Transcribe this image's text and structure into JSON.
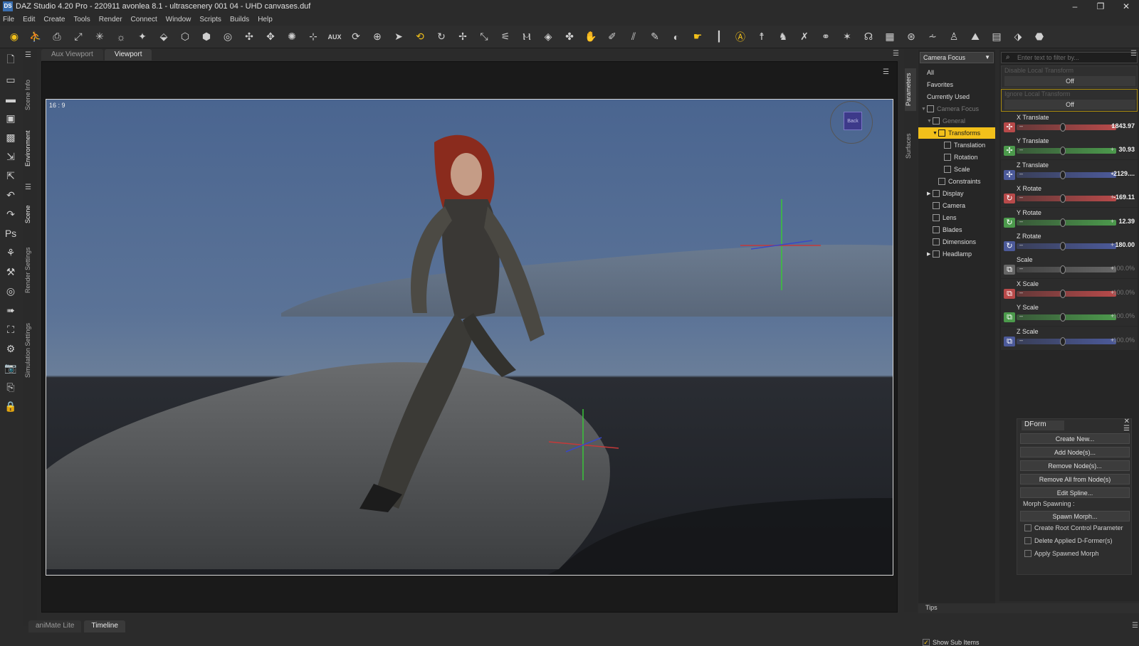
{
  "window": {
    "title": "DAZ Studio 4.20 Pro - 220911 avonlea 8.1 - ultrascenery 001 04 - UHD canvases.duf",
    "minimize": "–",
    "maximize": "❐",
    "close": "✕"
  },
  "menu": [
    "File",
    "Edit",
    "Create",
    "Tools",
    "Render",
    "Connect",
    "Window",
    "Scripts",
    "Builds",
    "Help"
  ],
  "toolbar": {
    "icons": [
      "daz-logo-icon",
      "scene-figure-icon",
      "camera-create-icon",
      "spotlight-icon",
      "distant-light-icon",
      "point-light-icon",
      "light-icon",
      "primitive-icon",
      "cube-icon",
      "group-icon",
      "dform-icon",
      "bone-icon",
      "joint-icon",
      "weight-icon",
      "transform-icon"
    ],
    "aux_label": "AUX"
  },
  "viewport_tabs": [
    "Aux Viewport",
    "Viewport"
  ],
  "viewport": {
    "aspect_label": "16 : 9",
    "cube_label": "Back"
  },
  "left_tabs": [
    "Scene Info",
    "Environment",
    "Scene",
    "Render Settings",
    "Simulation Settings"
  ],
  "right_tabs": [
    "Parameters",
    "Surfaces"
  ],
  "bottom_tabs": [
    "aniMate Lite",
    "Timeline"
  ],
  "params_panel": {
    "node_dropdown": "Camera Focus",
    "tree": [
      {
        "label": "All",
        "level": 0,
        "type": "plain"
      },
      {
        "label": "Favorites",
        "level": 0,
        "type": "plain"
      },
      {
        "label": "Currently Used",
        "level": 0,
        "type": "plain"
      },
      {
        "label": "Camera Focus",
        "level": 0,
        "type": "dim"
      },
      {
        "label": "General",
        "level": 1,
        "type": "dim"
      },
      {
        "label": "Transforms",
        "level": 2,
        "type": "highlight"
      },
      {
        "label": "Translation",
        "level": 3,
        "type": "plain"
      },
      {
        "label": "Rotation",
        "level": 3,
        "type": "plain"
      },
      {
        "label": "Scale",
        "level": 3,
        "type": "plain"
      },
      {
        "label": "Constraints",
        "level": 2,
        "type": "plain"
      },
      {
        "label": "Display",
        "level": 1,
        "type": "plain"
      },
      {
        "label": "Camera",
        "level": 1,
        "type": "plain"
      },
      {
        "label": "Lens",
        "level": 1,
        "type": "plain"
      },
      {
        "label": "Blades",
        "level": 1,
        "type": "plain"
      },
      {
        "label": "Dimensions",
        "level": 1,
        "type": "plain"
      },
      {
        "label": "Headlamp",
        "level": 1,
        "type": "plain"
      }
    ],
    "show_sub_items": "Show Sub Items",
    "tips": "Tips"
  },
  "filter_placeholder": "Enter text to filter by...",
  "toggles": [
    {
      "label": "Disable Local Transform",
      "value": "Off"
    },
    {
      "label": "Ignore Local Transform",
      "value": "Off"
    }
  ],
  "sliders": [
    {
      "label": "X Translate",
      "value": "1843.97",
      "kind": "translate",
      "color": "#b84a4a"
    },
    {
      "label": "Y Translate",
      "value": "30.93",
      "kind": "translate",
      "color": "#4c9a4c"
    },
    {
      "label": "Z Translate",
      "value": "-2129....",
      "kind": "translate",
      "color": "#4c5a9a"
    },
    {
      "label": "X Rotate",
      "value": "-169.11",
      "kind": "rotate",
      "color": "#b84a4a"
    },
    {
      "label": "Y Rotate",
      "value": "12.39",
      "kind": "rotate",
      "color": "#4c9a4c"
    },
    {
      "label": "Z Rotate",
      "value": "180.00",
      "kind": "rotate",
      "color": "#4c5a9a"
    },
    {
      "label": "Scale",
      "value": "100.0%",
      "kind": "scale",
      "color": "#666666"
    },
    {
      "label": "X Scale",
      "value": "100.0%",
      "kind": "scale",
      "color": "#b84a4a"
    },
    {
      "label": "Y Scale",
      "value": "100.0%",
      "kind": "scale",
      "color": "#4c9a4c"
    },
    {
      "label": "Z Scale",
      "value": "100.0%",
      "kind": "scale",
      "color": "#4c5a9a"
    }
  ],
  "dform": {
    "title": "DForm",
    "buttons": [
      "Create New...",
      "Add Node(s)...",
      "Remove Node(s)...",
      "Remove All from Node(s)",
      "Edit Spline..."
    ],
    "morph_label": "Morph Spawning :",
    "spawn_button": "Spawn Morph...",
    "checkboxes": [
      "Create Root Control Parameter",
      "Delete Applied D-Former(s)",
      "Apply Spawned Morph"
    ]
  },
  "colors": {
    "accent": "#f2c01a",
    "panel_bg": "#262626"
  }
}
